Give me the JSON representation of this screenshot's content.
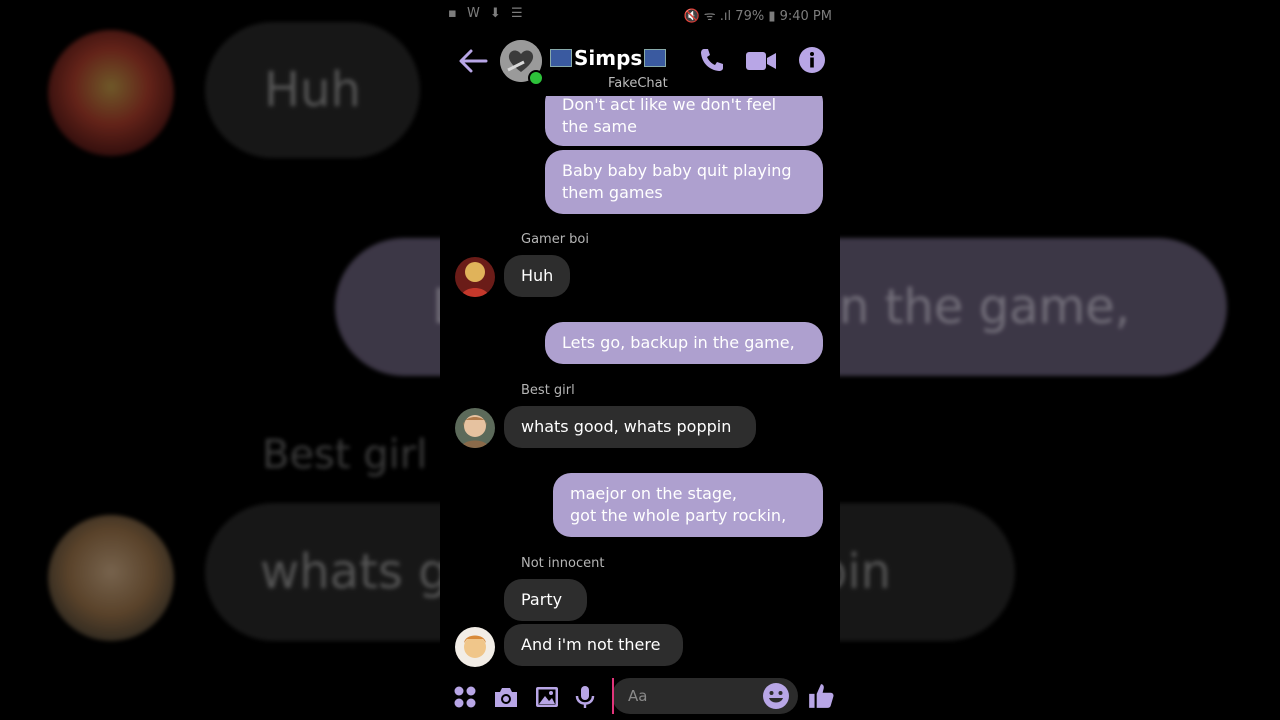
{
  "background": {
    "bubble_huh": "Huh",
    "bubble_game": "Lets go, backup in the game,",
    "label_best_girl": "Best girl",
    "bubble_whats": "whats good, whats poppin"
  },
  "status_bar": {
    "left_icons": "▪ W ⬇ ☰",
    "right_text": "🔇 ᯤ .ıl 79% ▮ 9:40 PM"
  },
  "header": {
    "back_icon": "arrow-left",
    "title": "Simps",
    "subtitle": "FakeChat",
    "accent_color": "#b8a6e6",
    "online_color": "#2dc23a"
  },
  "messages": [
    {
      "type": "out",
      "text_lines": [
        "Don't act like we don't feel",
        "the same"
      ]
    },
    {
      "type": "out",
      "text_lines": [
        "Baby baby baby quit playing",
        "them games"
      ]
    },
    {
      "type": "in",
      "sender": "Gamer boi",
      "text": "Huh"
    },
    {
      "type": "out",
      "text": "Lets go, backup in the game,"
    },
    {
      "type": "in",
      "sender": "Best girl",
      "text": "whats good, whats poppin"
    },
    {
      "type": "out",
      "text_lines": [
        "maejor on the stage,",
        "got the whole party rockin,"
      ]
    },
    {
      "type": "in",
      "sender": "Not innocent",
      "text": "Party"
    },
    {
      "type": "in",
      "text": "And i'm not there"
    }
  ],
  "composer": {
    "placeholder": "Aa",
    "value": ""
  }
}
